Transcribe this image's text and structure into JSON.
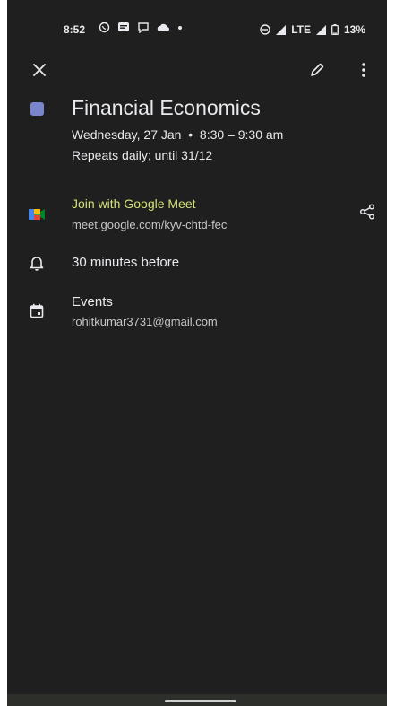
{
  "status_bar": {
    "time": "8:52",
    "network": "LTE",
    "battery": "13%",
    "icons": [
      "whatsapp-icon",
      "message-icon",
      "chat-icon",
      "cloud-icon",
      "dot-icon",
      "dnd-icon",
      "signal-icon",
      "signal-icon",
      "battery-icon"
    ]
  },
  "toolbar": {
    "close_icon": "close-icon",
    "edit_icon": "pencil-icon",
    "more_icon": "more-vert-icon"
  },
  "event": {
    "color": "#7986cb",
    "title": "Financial Economics",
    "date": "Wednesday, 27 Jan",
    "time_range": "8:30 – 9:30 am",
    "repeat": "Repeats daily; until 31/12"
  },
  "meet": {
    "label": "Join with Google Meet",
    "url": "meet.google.com/kyv-chtd-fec",
    "link_color": "#d6e179"
  },
  "reminder": {
    "text": "30 minutes before"
  },
  "calendar": {
    "name": "Events",
    "account": "rohitkumar3731@gmail.com"
  }
}
